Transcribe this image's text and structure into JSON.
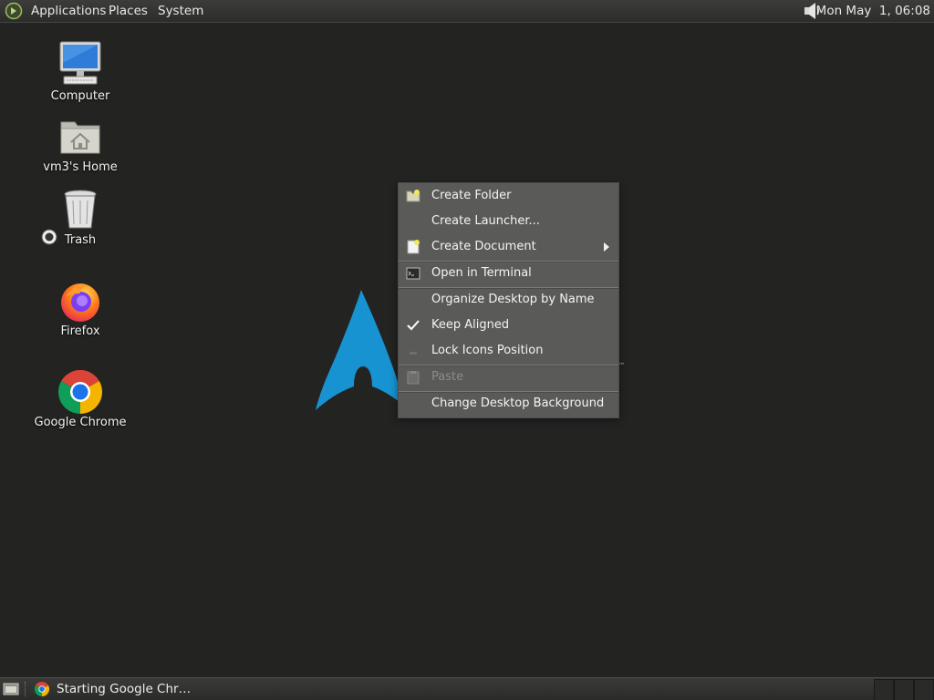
{
  "top_panel": {
    "menus": [
      "Applications",
      "Places",
      "System"
    ],
    "clock": "Mon May  1, 06:08",
    "logo_icon": "gnome-foot-icon",
    "volume_icon": "speaker-icon"
  },
  "desktop": {
    "icons": [
      {
        "label": "Computer",
        "icon": "computer-icon"
      },
      {
        "label": "vm3's Home",
        "icon": "home-folder-icon"
      },
      {
        "label": "Trash",
        "icon": "trash-icon"
      },
      {
        "label": "Firefox",
        "icon": "firefox-icon"
      },
      {
        "label": "Google Chrome",
        "icon": "chrome-icon"
      }
    ],
    "wallpaper_brand_mark": "™",
    "wallpaper_color": "#1793d1"
  },
  "context_menu": {
    "items": [
      {
        "label": "Create Folder",
        "icon": "new-folder-icon",
        "enabled": true
      },
      {
        "label": "Create Launcher...",
        "enabled": true
      },
      {
        "label": "Create Document",
        "icon": "new-document-icon",
        "enabled": true,
        "submenu": true
      },
      {
        "label": "Open in Terminal",
        "icon": "terminal-icon",
        "enabled": true
      },
      {
        "label": "Organize Desktop by Name",
        "enabled": true
      },
      {
        "label": "Keep Aligned",
        "icon": "checkmark-icon",
        "checked": true,
        "enabled": true
      },
      {
        "label": "Lock Icons Position",
        "enabled": true,
        "checked": false
      },
      {
        "label": "Paste",
        "icon": "paste-icon",
        "enabled": false
      },
      {
        "label": "Change Desktop Background",
        "enabled": true
      }
    ]
  },
  "bottom_panel": {
    "taskbar_label": "Starting Google Chr…",
    "taskbar_icon": "chrome-icon",
    "show_desktop_icon": "show-desktop-icon",
    "workspaces": 3
  }
}
